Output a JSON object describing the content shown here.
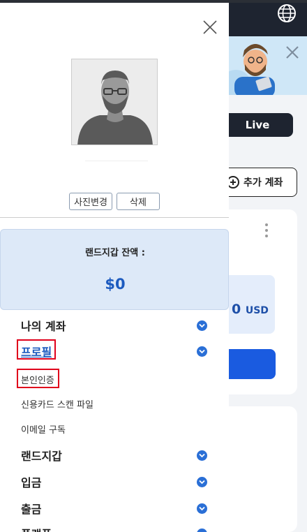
{
  "background": {
    "live_label": "Live",
    "add_account_label": "추가 계좌",
    "balance_amount": "0",
    "balance_currency": "USD"
  },
  "drawer": {
    "photo_buttons": {
      "change_label": "사진변경",
      "delete_label": "삭제"
    },
    "wallet": {
      "label": "랜드지갑 잔액 :",
      "amount": "$0"
    },
    "menu": {
      "my_account": "나의 계좌",
      "profile": "프로필",
      "verification": "본인인증",
      "card_scan": "신용카드 스캔 파일",
      "email_subscription": "이메일 구독",
      "land_wallet": "랜드지갑",
      "deposit": "입금",
      "withdraw": "출금",
      "platform": "플랫폼"
    }
  },
  "colors": {
    "accent_blue": "#1d5bbf",
    "highlight_red": "#e0001b",
    "header_dark": "#1e2430"
  }
}
